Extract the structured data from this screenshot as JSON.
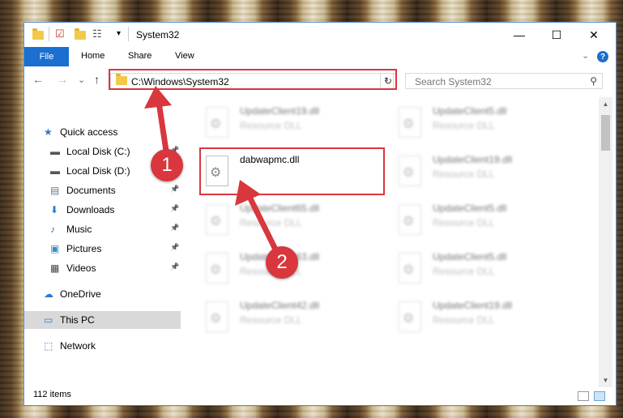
{
  "window": {
    "title": "System32",
    "controls": {
      "minimize": "—",
      "maximize": "☐",
      "close": "✕"
    }
  },
  "ribbon": {
    "file": "File",
    "tabs": [
      "Home",
      "Share",
      "View"
    ],
    "help": "?"
  },
  "nav": {
    "back": "←",
    "forward": "→",
    "recent": "⌄",
    "up": "↑",
    "address": "C:\\Windows\\System32",
    "refresh": "↻",
    "search_placeholder": "Search System32"
  },
  "sidebar": {
    "items": [
      {
        "label": "Quick access",
        "icon": "star-icon",
        "pinned": false
      },
      {
        "label": "Local Disk (C:)",
        "icon": "drive-icon",
        "pinned": true
      },
      {
        "label": "Local Disk (D:)",
        "icon": "drive-icon",
        "pinned": true
      },
      {
        "label": "Documents",
        "icon": "document-icon",
        "pinned": true
      },
      {
        "label": "Downloads",
        "icon": "download-icon",
        "pinned": true
      },
      {
        "label": "Music",
        "icon": "music-icon",
        "pinned": true
      },
      {
        "label": "Pictures",
        "icon": "picture-icon",
        "pinned": true
      },
      {
        "label": "Videos",
        "icon": "video-icon",
        "pinned": true
      },
      {
        "label": "OneDrive",
        "icon": "cloud-icon",
        "pinned": false
      },
      {
        "label": "This PC",
        "icon": "computer-icon",
        "pinned": false,
        "selected": true
      },
      {
        "label": "Network",
        "icon": "network-icon",
        "pinned": false
      }
    ]
  },
  "files": [
    {
      "name": "UpdateClient19.dll",
      "type": "Resource DLL",
      "blurred": true
    },
    {
      "name": "UpdateClient5.dll",
      "type": "Resource DLL",
      "blurred": true
    },
    {
      "name": "dabwapmc.dll",
      "type": "",
      "blurred": false
    },
    {
      "name": "UpdateClient19.dll",
      "type": "Resource DLL",
      "blurred": true
    },
    {
      "name": "UpdateClient65.dll",
      "type": "Resource DLL",
      "blurred": true
    },
    {
      "name": "UpdateClient5.dll",
      "type": "Resource DLL",
      "blurred": true
    },
    {
      "name": "UpdateClient63.dll",
      "type": "Resource DLL",
      "blurred": true
    },
    {
      "name": "UpdateClient5.dll",
      "type": "Resource DLL",
      "blurred": true
    },
    {
      "name": "UpdateClient42.dll",
      "type": "Resource DLL",
      "blurred": true
    },
    {
      "name": "UpdateClient19.dll",
      "type": "Resource DLL",
      "blurred": true
    }
  ],
  "status": {
    "items_count": "112 items"
  },
  "annotations": {
    "badge1": "1",
    "badge2": "2",
    "accent": "#d9363e"
  },
  "colors": {
    "file_tab": "#1a6fd1",
    "selected_nav": "#d9d9d9",
    "folder": "#f2c94c"
  }
}
